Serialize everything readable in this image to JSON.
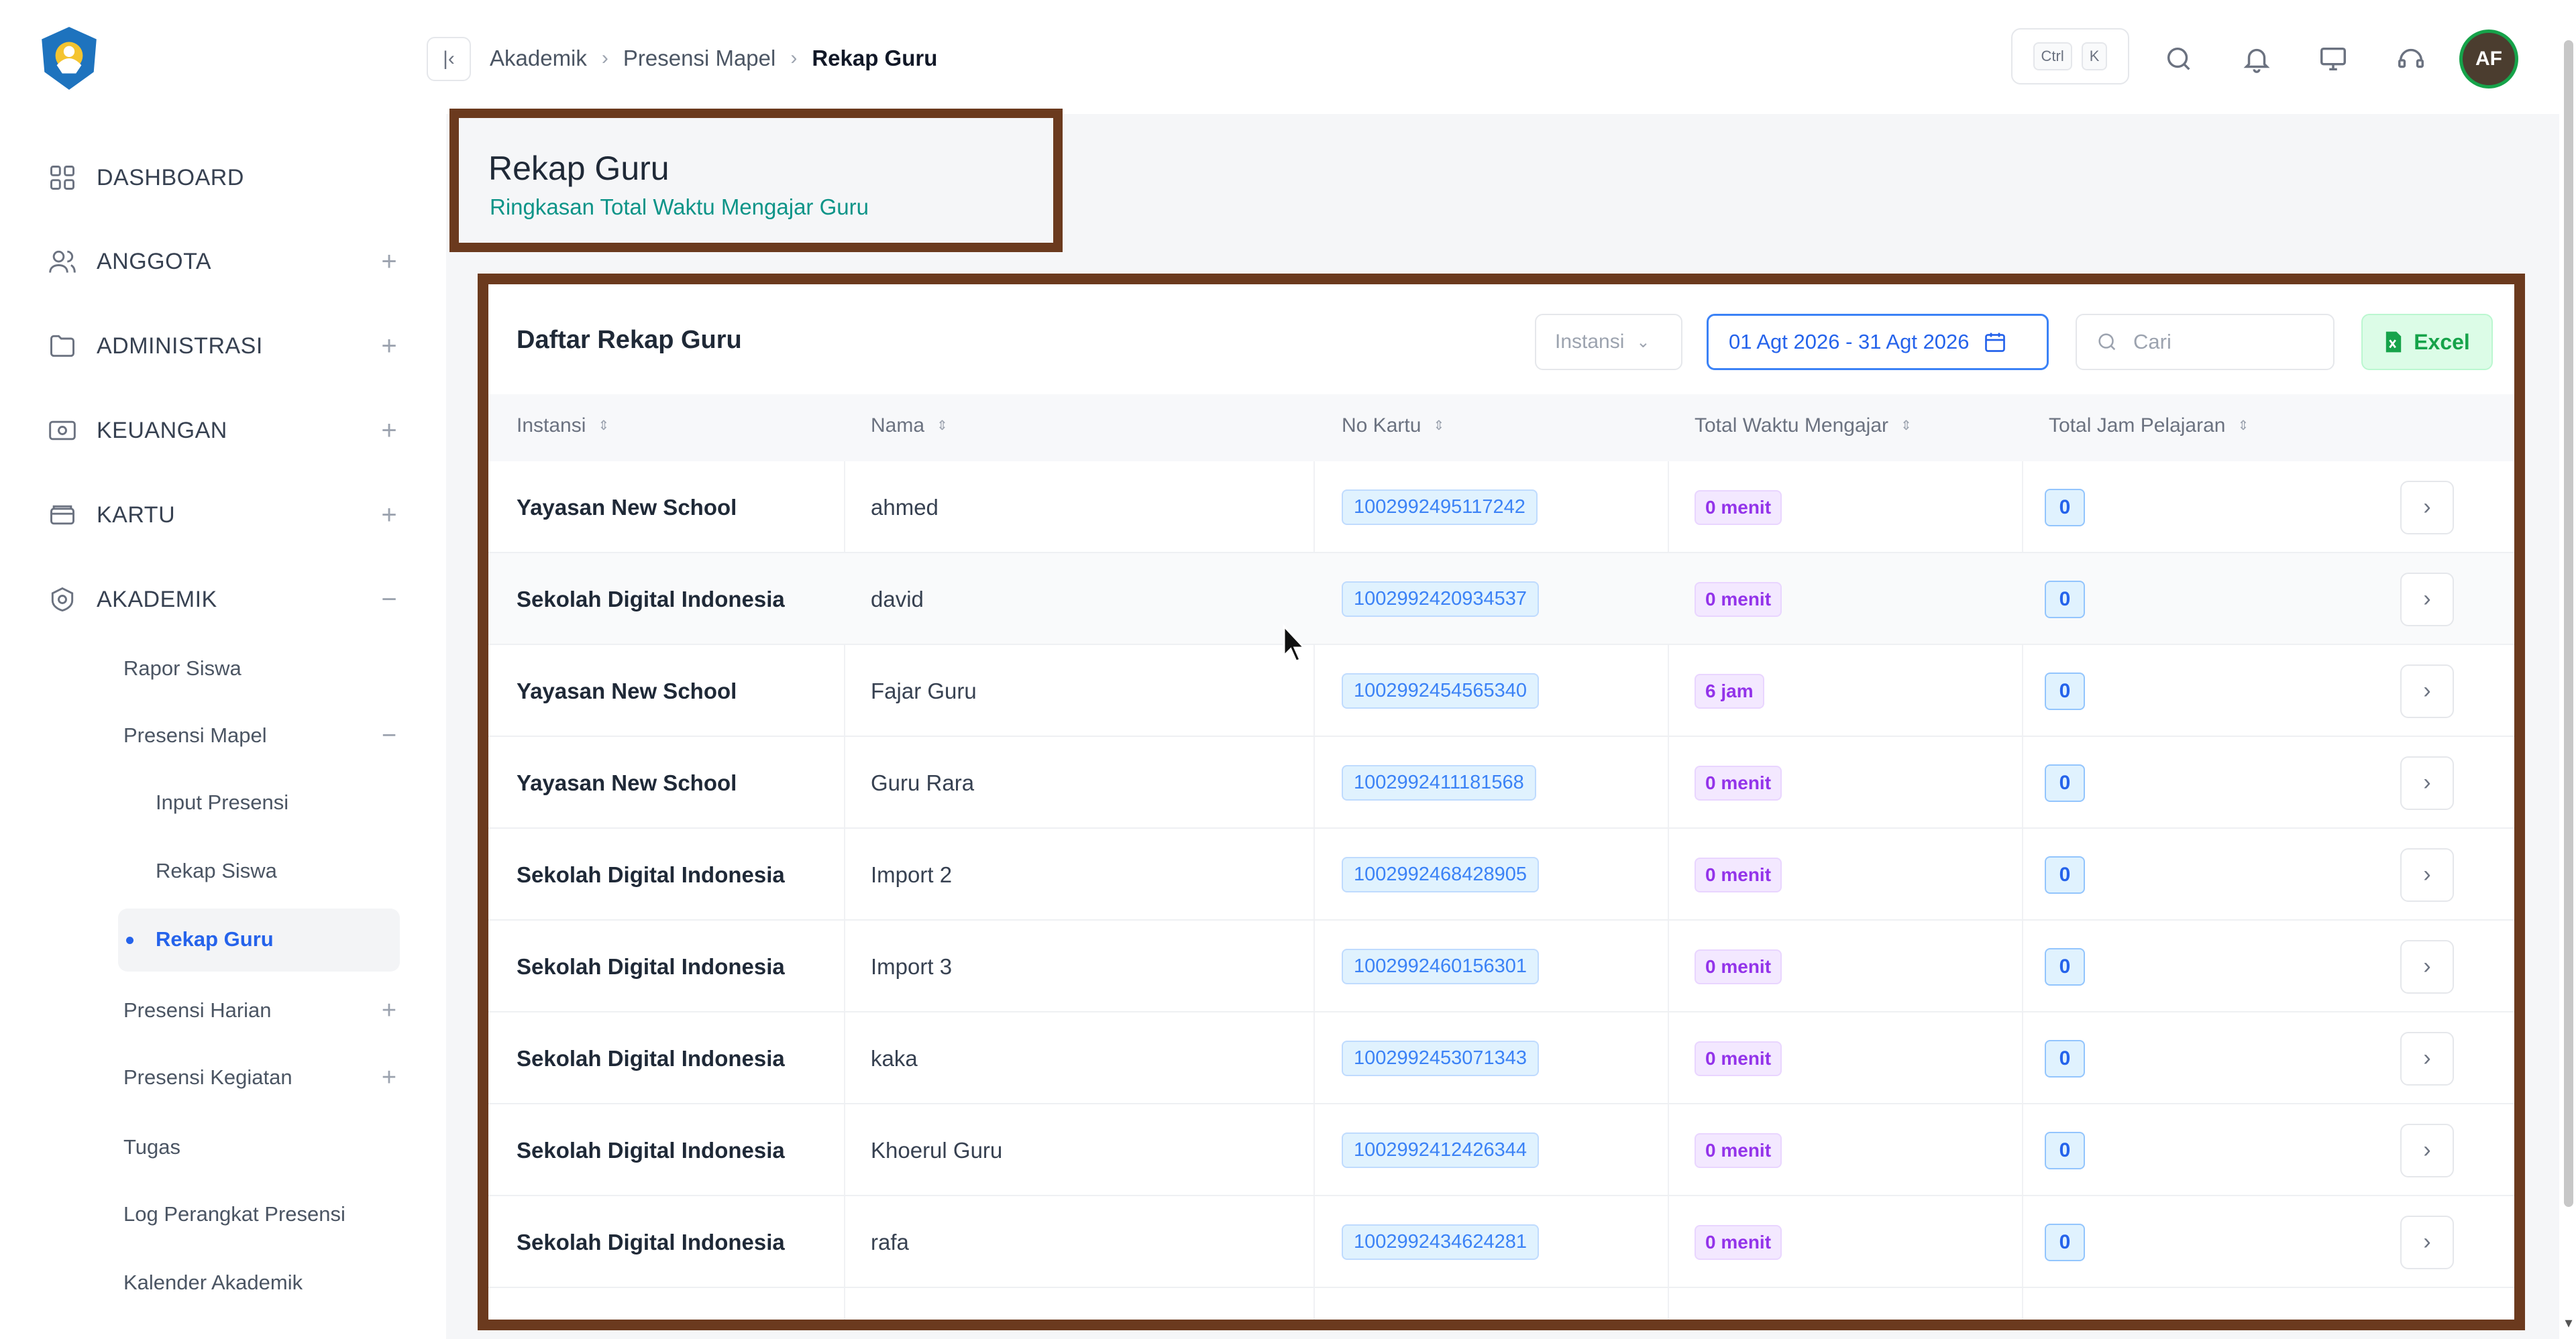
{
  "sidebar": {
    "logo": "tut-wuri-handayani-logo",
    "items": [
      {
        "label": "DASHBOARD",
        "icon": "grid-icon",
        "expander": ""
      },
      {
        "label": "ANGGOTA",
        "icon": "users-icon",
        "expander": "+"
      },
      {
        "label": "ADMINISTRASI",
        "icon": "folder-icon",
        "expander": "+"
      },
      {
        "label": "KEUANGAN",
        "icon": "money-icon",
        "expander": "+"
      },
      {
        "label": "KARTU",
        "icon": "card-icon",
        "expander": "+"
      },
      {
        "label": "AKADEMIK",
        "icon": "academic-icon",
        "expander": "−"
      }
    ],
    "akademik_sub": [
      {
        "label": "Rapor Siswa",
        "expander": ""
      },
      {
        "label": "Presensi Mapel",
        "expander": "−"
      },
      {
        "label": "Presensi Harian",
        "expander": "+"
      },
      {
        "label": "Presensi Kegiatan",
        "expander": "+"
      },
      {
        "label": "Tugas",
        "expander": ""
      },
      {
        "label": "Log Perangkat Presensi",
        "expander": ""
      },
      {
        "label": "Kalender Akademik",
        "expander": ""
      }
    ],
    "presensi_mapel_sub": [
      {
        "label": "Input Presensi"
      },
      {
        "label": "Rekap Siswa"
      },
      {
        "label": "Rekap Guru",
        "active": true
      }
    ]
  },
  "header": {
    "breadcrumb": [
      "Akademik",
      "Presensi Mapel",
      "Rekap Guru"
    ],
    "shortcut": [
      "Ctrl",
      "K"
    ],
    "avatar_initials": "AF"
  },
  "page": {
    "title": "Rekap Guru",
    "subtitle": "Ringkasan Total Waktu Mengajar Guru"
  },
  "card": {
    "title": "Daftar Rekap Guru",
    "instansi_placeholder": "Instansi",
    "date_range": "01 Agt 2026 - 31 Agt 2026",
    "search_placeholder": "Cari",
    "excel_label": "Excel"
  },
  "table": {
    "columns": [
      "Instansi",
      "Nama",
      "No Kartu",
      "Total Waktu Mengajar",
      "Total Jam Pelajaran"
    ],
    "rows": [
      {
        "instansi": "Yayasan New School",
        "nama": "ahmed",
        "no_kartu": "1002992495117242",
        "waktu": "0 menit",
        "jam": "0"
      },
      {
        "instansi": "Sekolah Digital Indonesia",
        "nama": "david",
        "no_kartu": "1002992420934537",
        "waktu": "0 menit",
        "jam": "0"
      },
      {
        "instansi": "Yayasan New School",
        "nama": "Fajar Guru",
        "no_kartu": "1002992454565340",
        "waktu": "6 jam",
        "jam": "0"
      },
      {
        "instansi": "Yayasan New School",
        "nama": "Guru Rara",
        "no_kartu": "1002992411181568",
        "waktu": "0 menit",
        "jam": "0"
      },
      {
        "instansi": "Sekolah Digital Indonesia",
        "nama": "Import 2",
        "no_kartu": "1002992468428905",
        "waktu": "0 menit",
        "jam": "0"
      },
      {
        "instansi": "Sekolah Digital Indonesia",
        "nama": "Import 3",
        "no_kartu": "1002992460156301",
        "waktu": "0 menit",
        "jam": "0"
      },
      {
        "instansi": "Sekolah Digital Indonesia",
        "nama": "kaka",
        "no_kartu": "1002992453071343",
        "waktu": "0 menit",
        "jam": "0"
      },
      {
        "instansi": "Sekolah Digital Indonesia",
        "nama": "Khoerul Guru",
        "no_kartu": "1002992412426344",
        "waktu": "0 menit",
        "jam": "0"
      },
      {
        "instansi": "Sekolah Digital Indonesia",
        "nama": "rafa",
        "no_kartu": "1002992434624281",
        "waktu": "0 menit",
        "jam": "0"
      }
    ]
  },
  "colors": {
    "accent": "#2563eb",
    "annotation_frame": "#6b3a1e",
    "excel_green": "#16a34a",
    "time_purple": "#9333ea"
  }
}
